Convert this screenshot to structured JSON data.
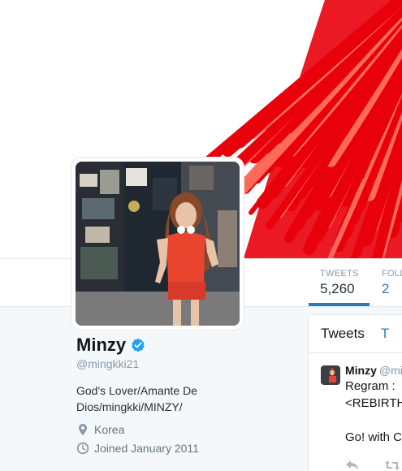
{
  "profile": {
    "name": "Minzy",
    "handle": "@mingkki21",
    "bio": "God's Lover/Amante De Dios/mingkki/MINZY/",
    "location": "Korea",
    "joined": "Joined January 2011",
    "verified": true
  },
  "nav": {
    "tweets_label": "TWEETS",
    "tweets_value": "5,260",
    "following_label": "FOLL",
    "following_value": "2"
  },
  "timeline": {
    "tabs": [
      "Tweets",
      "T"
    ],
    "tweet": {
      "name": "Minzy",
      "handle": "@mi",
      "text": "Regram :\n<REBIRTH\n\nGo! with C"
    }
  },
  "icons": {
    "verified": "verified-badge-icon",
    "location": "location-pin-icon",
    "joined": "calendar-clock-icon",
    "reply": "reply-icon",
    "retweet": "retweet-icon"
  },
  "colors": {
    "accent": "#2b7bb9",
    "verified": "#1da1f2",
    "banner_red": "#e8000b",
    "muted": "#8899a6"
  }
}
